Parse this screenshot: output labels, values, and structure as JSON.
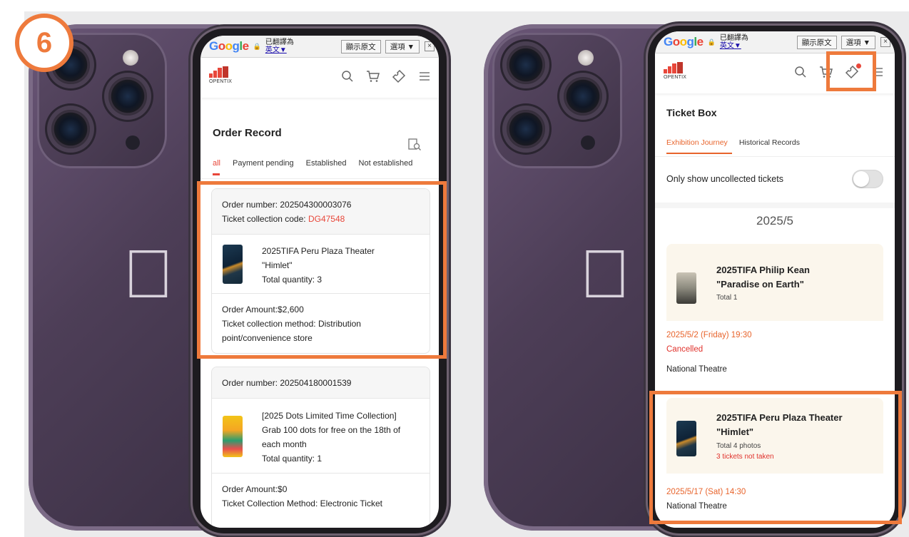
{
  "step": "6",
  "translate_bar": {
    "brand": [
      "G",
      "o",
      "o",
      "g",
      "l",
      "e"
    ],
    "translated_to": "已翻譯為",
    "language": "英文",
    "show_original": "顯示原文",
    "options": "選項 ▼",
    "close": "×"
  },
  "app": {
    "logo_text": "OPENTIX"
  },
  "left": {
    "page_title": "Order Record",
    "tabs": [
      "all",
      "Payment pending",
      "Established",
      "Not established"
    ],
    "orders": [
      {
        "number": "Order number: 202504300003076",
        "collection_code_label": "Ticket collection code:",
        "collection_code": "DG47548",
        "item_lines": [
          "2025TIFA Peru Plaza Theater",
          "\"Himlet\""
        ],
        "quantity": "Total quantity: 3",
        "amount": "Order Amount:$2,600",
        "method_lines": [
          "Ticket collection method: Distribution",
          "point/convenience store"
        ]
      },
      {
        "number": "Order number: 202504180001539",
        "item_lines": [
          "[2025 Dots Limited Time Collection]",
          "Grab 100 dots for free on the 18th of",
          "each month"
        ],
        "quantity": "Total quantity: 1",
        "amount": "Order Amount:$0",
        "method": "Ticket Collection Method: Electronic Ticket"
      }
    ]
  },
  "right": {
    "page_title": "Ticket Box",
    "tabs": [
      "Exhibition Journey",
      "Historical Records"
    ],
    "toggle_label": "Only show uncollected tickets",
    "month": "2025/5",
    "tickets": [
      {
        "title_lines": [
          "2025TIFA Philip Kean",
          "\"Paradise on Earth\""
        ],
        "total": "Total 1",
        "date": "2025/5/2 (Friday) 19:30",
        "status": "Cancelled",
        "venue": "National Theatre"
      },
      {
        "title_lines": [
          "2025TIFA Peru Plaza Theater",
          "\"Himlet\""
        ],
        "total": "Total 4 photos",
        "note": "3 tickets not taken",
        "date": "2025/5/17 (Sat) 14:30",
        "venue": "National Theatre"
      }
    ]
  },
  "colors": {
    "accent": "#ee7a3c",
    "brand_red": "#e8473a",
    "link_orange": "#e8642c"
  }
}
